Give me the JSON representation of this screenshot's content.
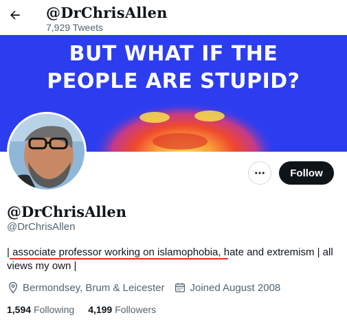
{
  "header": {
    "title": "@DrChrisAllen",
    "tweet_count": "7,929 Tweets",
    "back_icon": "arrow-left-icon"
  },
  "banner": {
    "line1": "BUT WHAT IF THE",
    "line2": "PEOPLE ARE STUPID?"
  },
  "actions": {
    "more_icon": "more-horizontal-icon",
    "follow_label": "Follow"
  },
  "profile": {
    "display_name": "@DrChrisAllen",
    "handle": "@DrChrisAllen",
    "bio": "| associate professor working on islamophobia, hate  and extremism | all views my own |",
    "location": "Bermondsey, Brum & Leicester",
    "joined": "Joined August 2008",
    "following_count": "1,594",
    "following_label": "Following",
    "followers_count": "4,199",
    "followers_label": "Followers"
  },
  "colors": {
    "banner_bg": "#2c3df0",
    "underline": "#e0301e",
    "follow_bg": "#0f1419"
  }
}
